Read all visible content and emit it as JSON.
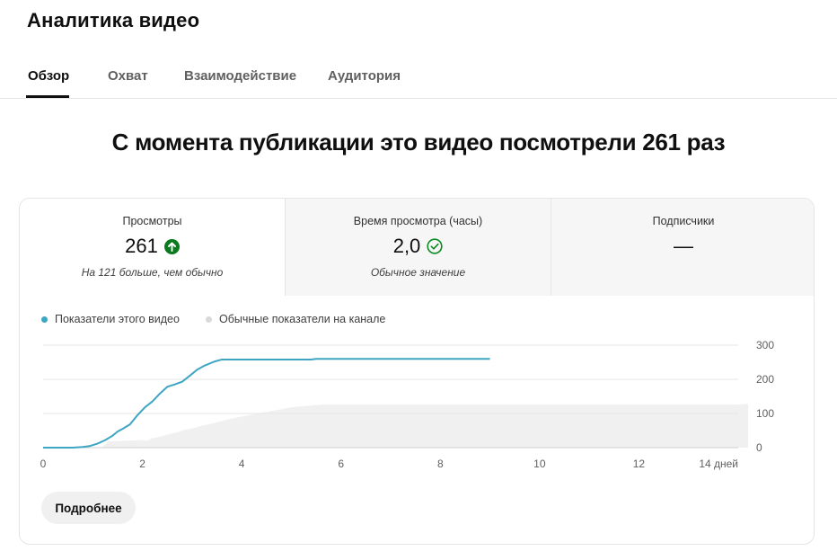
{
  "app": {
    "title": "Аналитика видео"
  },
  "tabs": [
    {
      "label": "Обзор",
      "active": true
    },
    {
      "label": "Охват",
      "active": false
    },
    {
      "label": "Взаимодействие",
      "active": false
    },
    {
      "label": "Аудитория",
      "active": false
    }
  ],
  "headline": "С момента публикации это видео посмотрели 261 раз",
  "metrics": [
    {
      "label": "Просмотры",
      "value": "261",
      "note": "На 121 больше, чем обычно",
      "icon": "arrow-up-circle-icon",
      "icon_color": "#0b7a1f"
    },
    {
      "label": "Время просмотра (часы)",
      "value": "2,0",
      "note": "Обычное значение",
      "icon": "check-circle-icon",
      "icon_color": "#0b8a20"
    },
    {
      "label": "Подписчики",
      "value": "—",
      "note": ""
    }
  ],
  "legend": {
    "this_video": "Показатели этого видео",
    "typical": "Обычные показатели на канале"
  },
  "colors": {
    "line": "#3ea5c3",
    "typical": "#f0f0f0",
    "typical_dot": "#d9d9d9"
  },
  "chart_data": {
    "type": "line",
    "x_unit": "дней",
    "xlim": [
      0,
      14
    ],
    "ylim": [
      0,
      300
    ],
    "x_ticks": [
      0,
      2,
      4,
      6,
      8,
      10,
      12,
      14
    ],
    "x_tick_labels": [
      "0",
      "2",
      "4",
      "6",
      "8",
      "10",
      "12",
      "14 дней"
    ],
    "y_ticks": [
      0,
      100,
      200,
      300
    ],
    "series": [
      {
        "name": "Показатели этого видео",
        "points": [
          [
            0,
            0
          ],
          [
            0.6,
            0
          ],
          [
            0.8,
            2
          ],
          [
            0.95,
            5
          ],
          [
            1.1,
            12
          ],
          [
            1.25,
            22
          ],
          [
            1.4,
            35
          ],
          [
            1.5,
            47
          ],
          [
            1.6,
            55
          ],
          [
            1.75,
            68
          ],
          [
            1.9,
            95
          ],
          [
            2.05,
            118
          ],
          [
            2.2,
            135
          ],
          [
            2.35,
            158
          ],
          [
            2.5,
            178
          ],
          [
            2.65,
            185
          ],
          [
            2.8,
            193
          ],
          [
            2.95,
            210
          ],
          [
            3.1,
            228
          ],
          [
            3.25,
            240
          ],
          [
            3.45,
            252
          ],
          [
            3.6,
            258
          ],
          [
            4.0,
            258
          ],
          [
            5.4,
            258
          ],
          [
            5.5,
            260
          ],
          [
            9.0,
            260
          ]
        ]
      },
      {
        "name": "Обычные показатели на канале",
        "points": [
          [
            1.2,
            0
          ],
          [
            1.3,
            18
          ],
          [
            1.6,
            20
          ],
          [
            2.0,
            22
          ],
          [
            2.1,
            20
          ],
          [
            2.2,
            28
          ],
          [
            2.35,
            32
          ],
          [
            2.5,
            38
          ],
          [
            2.7,
            45
          ],
          [
            2.85,
            52
          ],
          [
            3.05,
            58
          ],
          [
            3.2,
            64
          ],
          [
            3.45,
            72
          ],
          [
            3.65,
            80
          ],
          [
            3.9,
            88
          ],
          [
            4.15,
            95
          ],
          [
            4.4,
            102
          ],
          [
            4.7,
            110
          ],
          [
            5.0,
            118
          ],
          [
            5.3,
            122
          ],
          [
            5.6,
            126
          ],
          [
            14.0,
            126
          ],
          [
            14.2,
            128
          ]
        ]
      }
    ]
  },
  "more_button": "Подробнее"
}
